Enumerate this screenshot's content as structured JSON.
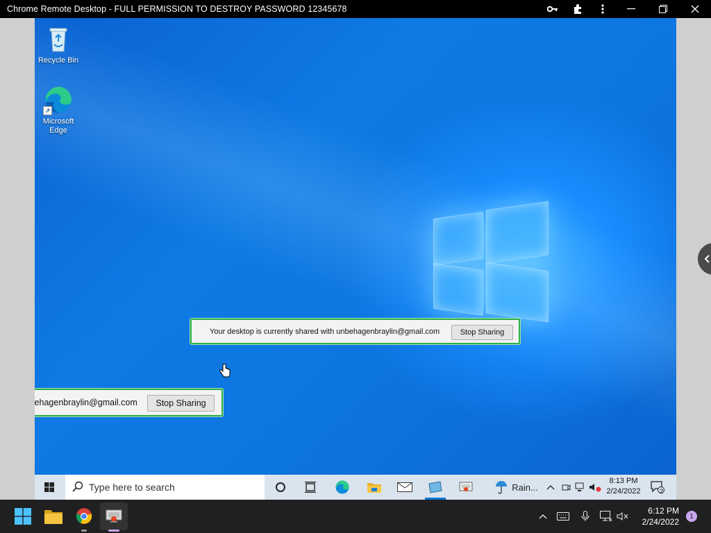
{
  "window": {
    "title": "Chrome Remote Desktop - FULL PERMISSION TO DESTROY PASSWORD 12345678",
    "controls": [
      "key-icon",
      "extensions-icon",
      "more-menu-icon",
      "minimize-icon",
      "restore-icon",
      "close-icon"
    ]
  },
  "desktop": {
    "icons": [
      {
        "label": "Recycle Bin",
        "icon": "recycle-bin-icon"
      },
      {
        "label": "Microsoft Edge",
        "icon": "edge-icon"
      }
    ]
  },
  "share_dialog": {
    "message": "Your desktop is currently shared with unbehagenbraylin@gmail.com",
    "stop_label": "Stop Sharing"
  },
  "share_dialog_clipped": {
    "message": "with unbehagenbraylin@gmail.com",
    "stop_label": "Stop Sharing"
  },
  "remote_taskbar": {
    "search_placeholder": "Type here to search",
    "weather": "Rain...",
    "time": "8:13 PM",
    "date": "2/24/2022",
    "notification_count": "2"
  },
  "host_taskbar": {
    "time": "6:12 PM",
    "date": "2/24/2022",
    "notification_count": "1"
  },
  "colors": {
    "share_border": "#2bb04a",
    "host_taskbar": "#202020",
    "notification_badge": "#c9a6f0"
  }
}
